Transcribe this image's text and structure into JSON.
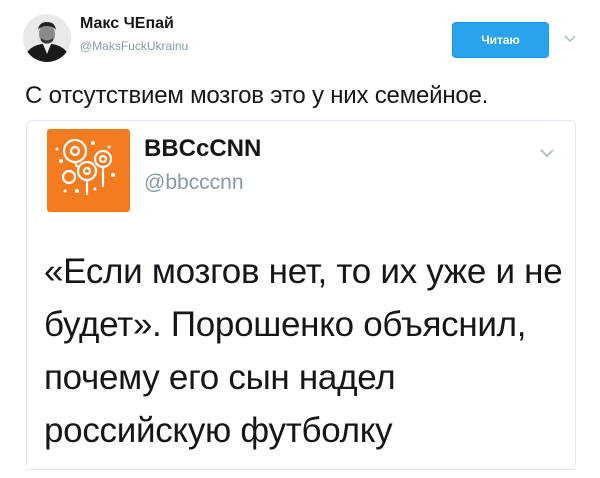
{
  "author": {
    "name": "Макс ЧЕпай",
    "handle": "@MaksFuckUkrainu"
  },
  "follow_button": {
    "label": "Читаю"
  },
  "tweet": {
    "text": "С отсутствием мозгов это у них семейное."
  },
  "quoted_tweet": {
    "name": "BBCcCNN",
    "handle": "@bbcccnn",
    "text": "«Если мозгов нет, то их уже и не будет». Порошенко объяснил, почему его сын надел российскую футболку"
  },
  "icons": {
    "avatar": "person-portrait-icon",
    "menu": "chevron-down-icon",
    "quoted_avatar": "orange-circles-logo-icon"
  },
  "colors": {
    "follow_button": "#2aa3ef",
    "handle": "#8899a6",
    "quoted_avatar": "#f47c20",
    "border": "#e1e8ed"
  }
}
